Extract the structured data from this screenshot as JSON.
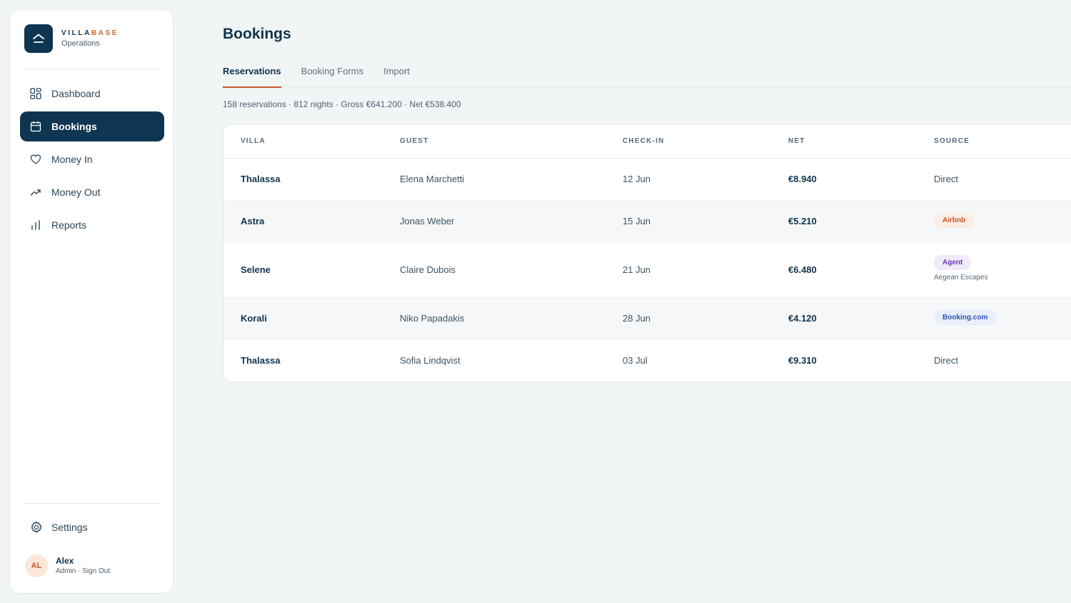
{
  "brand": {
    "name_part1": "VILLA",
    "name_part2": "BASE",
    "subtitle": "Operations"
  },
  "sidebar": {
    "items": [
      {
        "label": "Dashboard",
        "icon": "grid-icon",
        "active": false
      },
      {
        "label": "Bookings",
        "icon": "calendar-icon",
        "active": true
      },
      {
        "label": "Money In",
        "icon": "heart-icon",
        "active": false
      },
      {
        "label": "Money Out",
        "icon": "trend-up-icon",
        "active": false
      },
      {
        "label": "Reports",
        "icon": "bar-chart-icon",
        "active": false
      }
    ],
    "settings_label": "Settings",
    "user": {
      "initials": "AL",
      "name": "Alex",
      "meta": "Admin · Sign Out"
    }
  },
  "main": {
    "title": "Bookings",
    "tabs": [
      {
        "label": "Reservations",
        "active": true
      },
      {
        "label": "Booking Forms",
        "active": false
      },
      {
        "label": "Import",
        "active": false
      }
    ],
    "summary": "158 reservations · 812 nights · Gross €641.200 · Net €538.400"
  },
  "table": {
    "columns": [
      "VILLA",
      "GUEST",
      "CHECK-IN",
      "NET",
      "SOURCE"
    ],
    "rows": [
      {
        "villa": "Thalassa",
        "guest": "Elena Marchetti",
        "checkin": "12 Jun",
        "net": "€8.940",
        "source": "Direct",
        "source_type": "plain",
        "source_note": ""
      },
      {
        "villa": "Astra",
        "guest": "Jonas Weber",
        "checkin": "15 Jun",
        "net": "€5.210",
        "source": "Airbnb",
        "source_type": "airbnb",
        "source_note": ""
      },
      {
        "villa": "Selene",
        "guest": "Claire Dubois",
        "checkin": "21 Jun",
        "net": "€6.480",
        "source": "Agent",
        "source_type": "agent",
        "source_note": "Aegean Escapes"
      },
      {
        "villa": "Korali",
        "guest": "Niko Papadakis",
        "checkin": "28 Jun",
        "net": "€4.120",
        "source": "Booking.com",
        "source_type": "booking",
        "source_note": ""
      },
      {
        "villa": "Thalassa",
        "guest": "Sofia Lindqvist",
        "checkin": "03 Jul",
        "net": "€9.310",
        "source": "Direct",
        "source_type": "plain",
        "source_note": ""
      }
    ]
  },
  "colors": {
    "primary": "#0e3552",
    "accent": "#d1652e",
    "background": "#f1f5f6"
  }
}
